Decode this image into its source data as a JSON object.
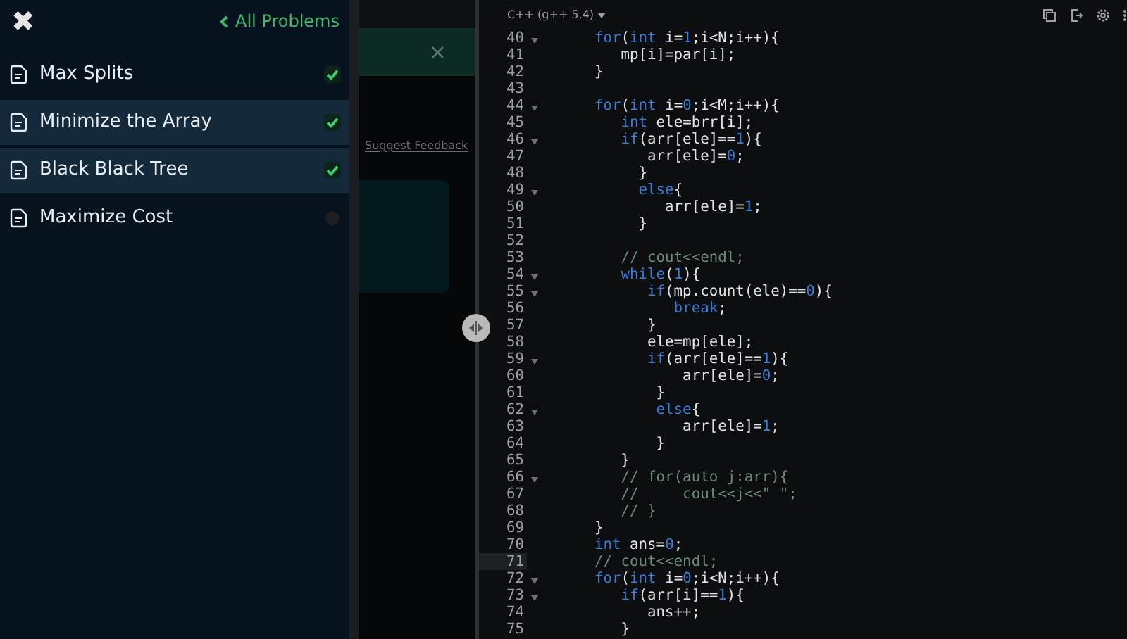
{
  "sidebar": {
    "close_icon": "✖",
    "back_link": "All Problems",
    "items": [
      {
        "title": "Max Splits",
        "solved": true,
        "selected": false
      },
      {
        "title": "Minimize the Array",
        "solved": true,
        "selected": true
      },
      {
        "title": "Black Black Tree",
        "solved": true,
        "selected": true
      },
      {
        "title": "Maximize Cost",
        "solved": false,
        "selected": false
      }
    ]
  },
  "problem_panel": {
    "banner_close": "×",
    "feedback_link": "Suggest Feedback"
  },
  "editor": {
    "language": "C++ (g++ 5.4)",
    "lines": [
      {
        "number": "40",
        "foldable": true,
        "current": false,
        "tokens": [
          {
            "kind": "keyword",
            "text": "for"
          },
          {
            "kind": "plain",
            "text": "("
          },
          {
            "kind": "keyword",
            "text": "int"
          },
          {
            "kind": "plain",
            "text": " i="
          },
          {
            "kind": "number",
            "text": "1"
          },
          {
            "kind": "plain",
            "text": ";i<N;i++){"
          }
        ]
      },
      {
        "number": "41",
        "foldable": false,
        "current": false,
        "tokens": [
          {
            "kind": "plain",
            "text": "   mp[i]=par[i];"
          }
        ]
      },
      {
        "number": "42",
        "foldable": false,
        "current": false,
        "tokens": [
          {
            "kind": "plain",
            "text": "}"
          }
        ]
      },
      {
        "number": "43",
        "foldable": false,
        "current": false
      },
      {
        "number": "44",
        "foldable": true,
        "current": false,
        "tokens": [
          {
            "kind": "keyword",
            "text": "for"
          },
          {
            "kind": "plain",
            "text": "("
          },
          {
            "kind": "keyword",
            "text": "int"
          },
          {
            "kind": "plain",
            "text": " i="
          },
          {
            "kind": "number",
            "text": "0"
          },
          {
            "kind": "plain",
            "text": ";i<M;i++){"
          }
        ]
      },
      {
        "number": "45",
        "foldable": false,
        "current": false,
        "tokens": [
          {
            "kind": "keyword",
            "text": "   int"
          },
          {
            "kind": "plain",
            "text": " ele=brr[i];"
          }
        ]
      },
      {
        "number": "46",
        "foldable": true,
        "current": false,
        "tokens": [
          {
            "kind": "keyword",
            "text": "   if"
          },
          {
            "kind": "plain",
            "text": "(arr[ele]=="
          },
          {
            "kind": "number",
            "text": "1"
          },
          {
            "kind": "plain",
            "text": "){"
          }
        ]
      },
      {
        "number": "47",
        "foldable": false,
        "current": false,
        "tokens": [
          {
            "kind": "plain",
            "text": "      arr[ele]="
          },
          {
            "kind": "number",
            "text": "0"
          },
          {
            "kind": "plain",
            "text": ";"
          }
        ]
      },
      {
        "number": "48",
        "foldable": false,
        "current": false,
        "tokens": [
          {
            "kind": "plain",
            "text": "     }"
          }
        ]
      },
      {
        "number": "49",
        "foldable": true,
        "current": false,
        "tokens": [
          {
            "kind": "keyword",
            "text": "     else"
          },
          {
            "kind": "plain",
            "text": "{"
          }
        ]
      },
      {
        "number": "50",
        "foldable": false,
        "current": false,
        "tokens": [
          {
            "kind": "plain",
            "text": "        arr[ele]="
          },
          {
            "kind": "number",
            "text": "1"
          },
          {
            "kind": "plain",
            "text": ";"
          }
        ]
      },
      {
        "number": "51",
        "foldable": false,
        "current": false,
        "tokens": [
          {
            "kind": "plain",
            "text": "     }"
          }
        ]
      },
      {
        "number": "52",
        "foldable": false,
        "current": false
      },
      {
        "number": "53",
        "foldable": false,
        "current": false,
        "tokens": [
          {
            "kind": "comment",
            "text": "   // cout<<endl;"
          }
        ]
      },
      {
        "number": "54",
        "foldable": true,
        "current": false,
        "tokens": [
          {
            "kind": "keyword",
            "text": "   while"
          },
          {
            "kind": "plain",
            "text": "("
          },
          {
            "kind": "number",
            "text": "1"
          },
          {
            "kind": "plain",
            "text": "){"
          }
        ]
      },
      {
        "number": "55",
        "foldable": true,
        "current": false,
        "tokens": [
          {
            "kind": "keyword",
            "text": "      if"
          },
          {
            "kind": "plain",
            "text": "(mp.count(ele)=="
          },
          {
            "kind": "number",
            "text": "0"
          },
          {
            "kind": "plain",
            "text": "){"
          }
        ]
      },
      {
        "number": "56",
        "foldable": false,
        "current": false,
        "tokens": [
          {
            "kind": "keyword",
            "text": "         break"
          },
          {
            "kind": "plain",
            "text": ";"
          }
        ]
      },
      {
        "number": "57",
        "foldable": false,
        "current": false,
        "tokens": [
          {
            "kind": "plain",
            "text": "      }"
          }
        ]
      },
      {
        "number": "58",
        "foldable": false,
        "current": false,
        "tokens": [
          {
            "kind": "plain",
            "text": "      ele=mp[ele];"
          }
        ]
      },
      {
        "number": "59",
        "foldable": true,
        "current": false,
        "tokens": [
          {
            "kind": "keyword",
            "text": "      if"
          },
          {
            "kind": "plain",
            "text": "(arr[ele]=="
          },
          {
            "kind": "number",
            "text": "1"
          },
          {
            "kind": "plain",
            "text": "){"
          }
        ]
      },
      {
        "number": "60",
        "foldable": false,
        "current": false,
        "tokens": [
          {
            "kind": "plain",
            "text": "          arr[ele]="
          },
          {
            "kind": "number",
            "text": "0"
          },
          {
            "kind": "plain",
            "text": ";"
          }
        ]
      },
      {
        "number": "61",
        "foldable": false,
        "current": false,
        "tokens": [
          {
            "kind": "plain",
            "text": "       }"
          }
        ]
      },
      {
        "number": "62",
        "foldable": true,
        "current": false,
        "tokens": [
          {
            "kind": "keyword",
            "text": "       else"
          },
          {
            "kind": "plain",
            "text": "{"
          }
        ]
      },
      {
        "number": "63",
        "foldable": false,
        "current": false,
        "tokens": [
          {
            "kind": "plain",
            "text": "          arr[ele]="
          },
          {
            "kind": "number",
            "text": "1"
          },
          {
            "kind": "plain",
            "text": ";"
          }
        ]
      },
      {
        "number": "64",
        "foldable": false,
        "current": false,
        "tokens": [
          {
            "kind": "plain",
            "text": "       }"
          }
        ]
      },
      {
        "number": "65",
        "foldable": false,
        "current": false,
        "tokens": [
          {
            "kind": "plain",
            "text": "   }"
          }
        ]
      },
      {
        "number": "66",
        "foldable": true,
        "current": false,
        "tokens": [
          {
            "kind": "comment",
            "text": "   // for(auto j:arr){"
          }
        ]
      },
      {
        "number": "67",
        "foldable": false,
        "current": false,
        "tokens": [
          {
            "kind": "comment",
            "text": "   //     cout<<j<<\" \";"
          }
        ]
      },
      {
        "number": "68",
        "foldable": false,
        "current": false,
        "tokens": [
          {
            "kind": "comment",
            "text": "   // }"
          }
        ]
      },
      {
        "number": "69",
        "foldable": false,
        "current": false,
        "tokens": [
          {
            "kind": "plain",
            "text": "}"
          }
        ]
      },
      {
        "number": "70",
        "foldable": false,
        "current": false,
        "tokens": [
          {
            "kind": "keyword",
            "text": "int"
          },
          {
            "kind": "plain",
            "text": " ans="
          },
          {
            "kind": "number",
            "text": "0"
          },
          {
            "kind": "plain",
            "text": ";"
          }
        ]
      },
      {
        "number": "71",
        "foldable": false,
        "current": true,
        "tokens": [
          {
            "kind": "comment",
            "text": "// cout<<endl;"
          }
        ]
      },
      {
        "number": "72",
        "foldable": true,
        "current": false,
        "tokens": [
          {
            "kind": "keyword",
            "text": "for"
          },
          {
            "kind": "plain",
            "text": "("
          },
          {
            "kind": "keyword",
            "text": "int"
          },
          {
            "kind": "plain",
            "text": " i="
          },
          {
            "kind": "number",
            "text": "0"
          },
          {
            "kind": "plain",
            "text": ";i<N;i++){"
          }
        ]
      },
      {
        "number": "73",
        "foldable": true,
        "current": false,
        "tokens": [
          {
            "kind": "keyword",
            "text": "   if"
          },
          {
            "kind": "plain",
            "text": "(arr[i]=="
          },
          {
            "kind": "number",
            "text": "1"
          },
          {
            "kind": "plain",
            "text": "){"
          }
        ]
      },
      {
        "number": "74",
        "foldable": false,
        "current": false,
        "tokens": [
          {
            "kind": "plain",
            "text": "      ans++;"
          }
        ]
      },
      {
        "number": "75",
        "foldable": false,
        "current": false,
        "tokens": [
          {
            "kind": "plain",
            "text": "   }"
          }
        ]
      }
    ]
  }
}
